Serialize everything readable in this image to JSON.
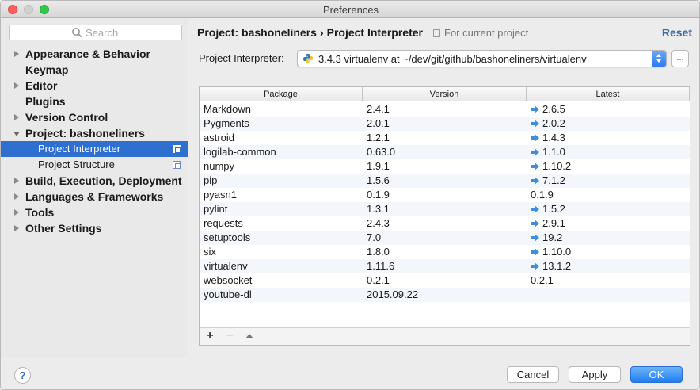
{
  "window": {
    "title": "Preferences"
  },
  "sidebar": {
    "search_placeholder": "Search",
    "items": [
      {
        "label": "Appearance & Behavior",
        "arrow": "collapsed"
      },
      {
        "label": "Keymap",
        "arrow": "none"
      },
      {
        "label": "Editor",
        "arrow": "collapsed"
      },
      {
        "label": "Plugins",
        "arrow": "none"
      },
      {
        "label": "Version Control",
        "arrow": "collapsed"
      },
      {
        "label": "Project: bashoneliners",
        "arrow": "expanded"
      },
      {
        "label": "Project Interpreter",
        "arrow": "none",
        "sub": true,
        "selected": true
      },
      {
        "label": "Project Structure",
        "arrow": "none",
        "sub": true
      },
      {
        "label": "Build, Execution, Deployment",
        "arrow": "collapsed"
      },
      {
        "label": "Languages & Frameworks",
        "arrow": "collapsed"
      },
      {
        "label": "Tools",
        "arrow": "collapsed"
      },
      {
        "label": "Other Settings",
        "arrow": "collapsed"
      }
    ]
  },
  "main": {
    "breadcrumb": {
      "project": "Project: bashoneliners",
      "separator": "›",
      "page": "Project Interpreter"
    },
    "scope": "For current project",
    "reset_label": "Reset",
    "interpreter_label": "Project Interpreter:",
    "interpreter_value": "3.4.3 virtualenv at ~/dev/git/github/bashoneliners/virtualenv",
    "more_label": "...",
    "table": {
      "headers": [
        "Package",
        "Version",
        "Latest"
      ],
      "rows": [
        {
          "package": "Markdown",
          "version": "2.4.1",
          "latest": "2.6.5",
          "upgrade": true
        },
        {
          "package": "Pygments",
          "version": "2.0.1",
          "latest": "2.0.2",
          "upgrade": true
        },
        {
          "package": "astroid",
          "version": "1.2.1",
          "latest": "1.4.3",
          "upgrade": true
        },
        {
          "package": "logilab-common",
          "version": "0.63.0",
          "latest": "1.1.0",
          "upgrade": true
        },
        {
          "package": "numpy",
          "version": "1.9.1",
          "latest": "1.10.2",
          "upgrade": true
        },
        {
          "package": "pip",
          "version": "1.5.6",
          "latest": "7.1.2",
          "upgrade": true
        },
        {
          "package": "pyasn1",
          "version": "0.1.9",
          "latest": "0.1.9",
          "upgrade": false
        },
        {
          "package": "pylint",
          "version": "1.3.1",
          "latest": "1.5.2",
          "upgrade": true
        },
        {
          "package": "requests",
          "version": "2.4.3",
          "latest": "2.9.1",
          "upgrade": true
        },
        {
          "package": "setuptools",
          "version": "7.0",
          "latest": "19.2",
          "upgrade": true
        },
        {
          "package": "six",
          "version": "1.8.0",
          "latest": "1.10.0",
          "upgrade": true
        },
        {
          "package": "virtualenv",
          "version": "1.11.6",
          "latest": "13.1.2",
          "upgrade": true
        },
        {
          "package": "websocket",
          "version": "0.2.1",
          "latest": "0.2.1",
          "upgrade": false
        },
        {
          "package": "youtube-dl",
          "version": "2015.09.22",
          "latest": "",
          "upgrade": false
        }
      ]
    },
    "toolbar": {
      "add": "+",
      "remove": "−"
    }
  },
  "footer": {
    "help_label": "?",
    "cancel_label": "Cancel",
    "apply_label": "Apply",
    "ok_label": "OK"
  },
  "colors": {
    "selection": "#2f6fcf",
    "accent": "#1f7ef2",
    "upgrade_arrow": "#3d8fde",
    "link": "#3b6ea5"
  }
}
